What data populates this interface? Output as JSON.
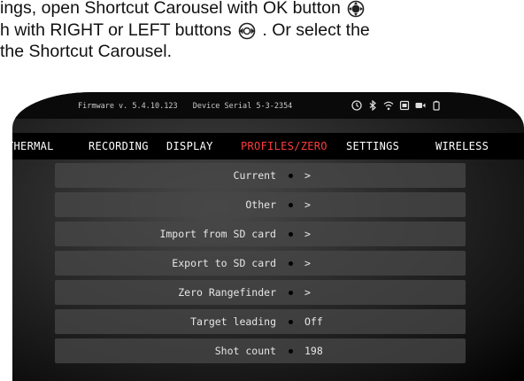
{
  "doc_text": {
    "line1": "ings, open Shortcut Carousel with OK button",
    "line2_a": "h with RIGHT or LEFT buttons",
    "line2_b": ". Or select the",
    "line3": "the Shortcut Carousel.",
    "ok_button_icon": "ok-button-icon",
    "dpad_icon": "left-right-dpad-icon"
  },
  "status_bar": {
    "firmware": "Firmware v. 5.4.10.123",
    "serial": "Device Serial 5-3-2354",
    "icons": [
      "clock-icon",
      "bluetooth-icon",
      "wifi-icon",
      "sd-card-icon",
      "video-icon",
      "battery-icon"
    ]
  },
  "tabs": [
    {
      "label": "THERMAL"
    },
    {
      "label": "RECORDING"
    },
    {
      "label": "DISPLAY"
    },
    {
      "label": "PROFILES/ZERO"
    },
    {
      "label": "SETTINGS"
    },
    {
      "label": "WIRELESS"
    }
  ],
  "active_tab": "PROFILES/ZERO",
  "accent_color": "#ff3c3c",
  "menu_items": [
    {
      "label": "Current",
      "value": ">"
    },
    {
      "label": "Other",
      "value": ">"
    },
    {
      "label": "Import from SD card",
      "value": ">"
    },
    {
      "label": "Export to SD card",
      "value": ">"
    },
    {
      "label": "Zero Rangefinder",
      "value": ">"
    },
    {
      "label": "Target leading",
      "value": "Off"
    },
    {
      "label": "Shot count",
      "value": "198"
    }
  ]
}
